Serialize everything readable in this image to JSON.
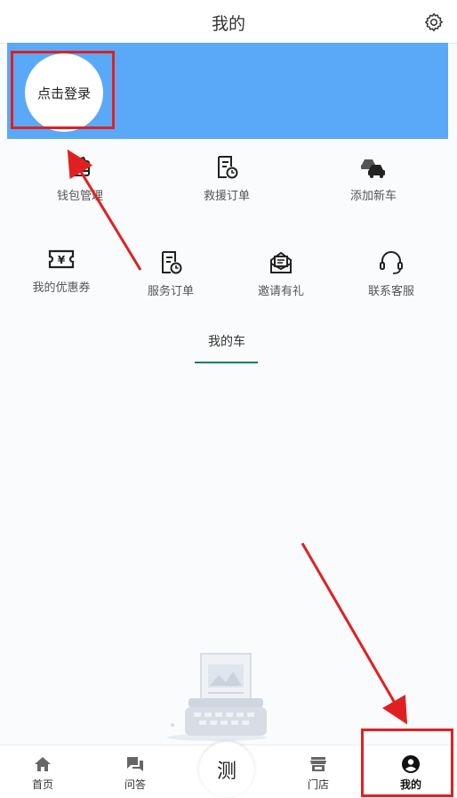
{
  "header": {
    "title": "我的",
    "settings_icon": "gear-icon"
  },
  "login": {
    "label": "点击登录"
  },
  "menu": {
    "items": [
      {
        "label": "钱包管理",
        "icon": "wallet-icon"
      },
      {
        "label": "救援订单",
        "icon": "rescue-order-icon"
      },
      {
        "label": "添加新车",
        "icon": "add-car-icon"
      },
      {
        "label": "我的优惠券",
        "icon": "coupon-icon"
      },
      {
        "label": "服务订单",
        "icon": "service-order-icon"
      },
      {
        "label": "邀请有礼",
        "icon": "invite-icon"
      },
      {
        "label": "联系客服",
        "icon": "headset-icon"
      }
    ]
  },
  "tabs": {
    "my_car": "我的车"
  },
  "tabbar": {
    "items": [
      {
        "label": "首页",
        "icon": "home-icon"
      },
      {
        "label": "问答",
        "icon": "chat-icon"
      },
      {
        "label": "测",
        "icon": ""
      },
      {
        "label": "门店",
        "icon": "store-icon"
      },
      {
        "label": "我的",
        "icon": "user-icon"
      }
    ]
  },
  "colors": {
    "banner": "#5aa9f8",
    "highlight": "#e02020",
    "tab_underline": "#0e7a6a"
  }
}
